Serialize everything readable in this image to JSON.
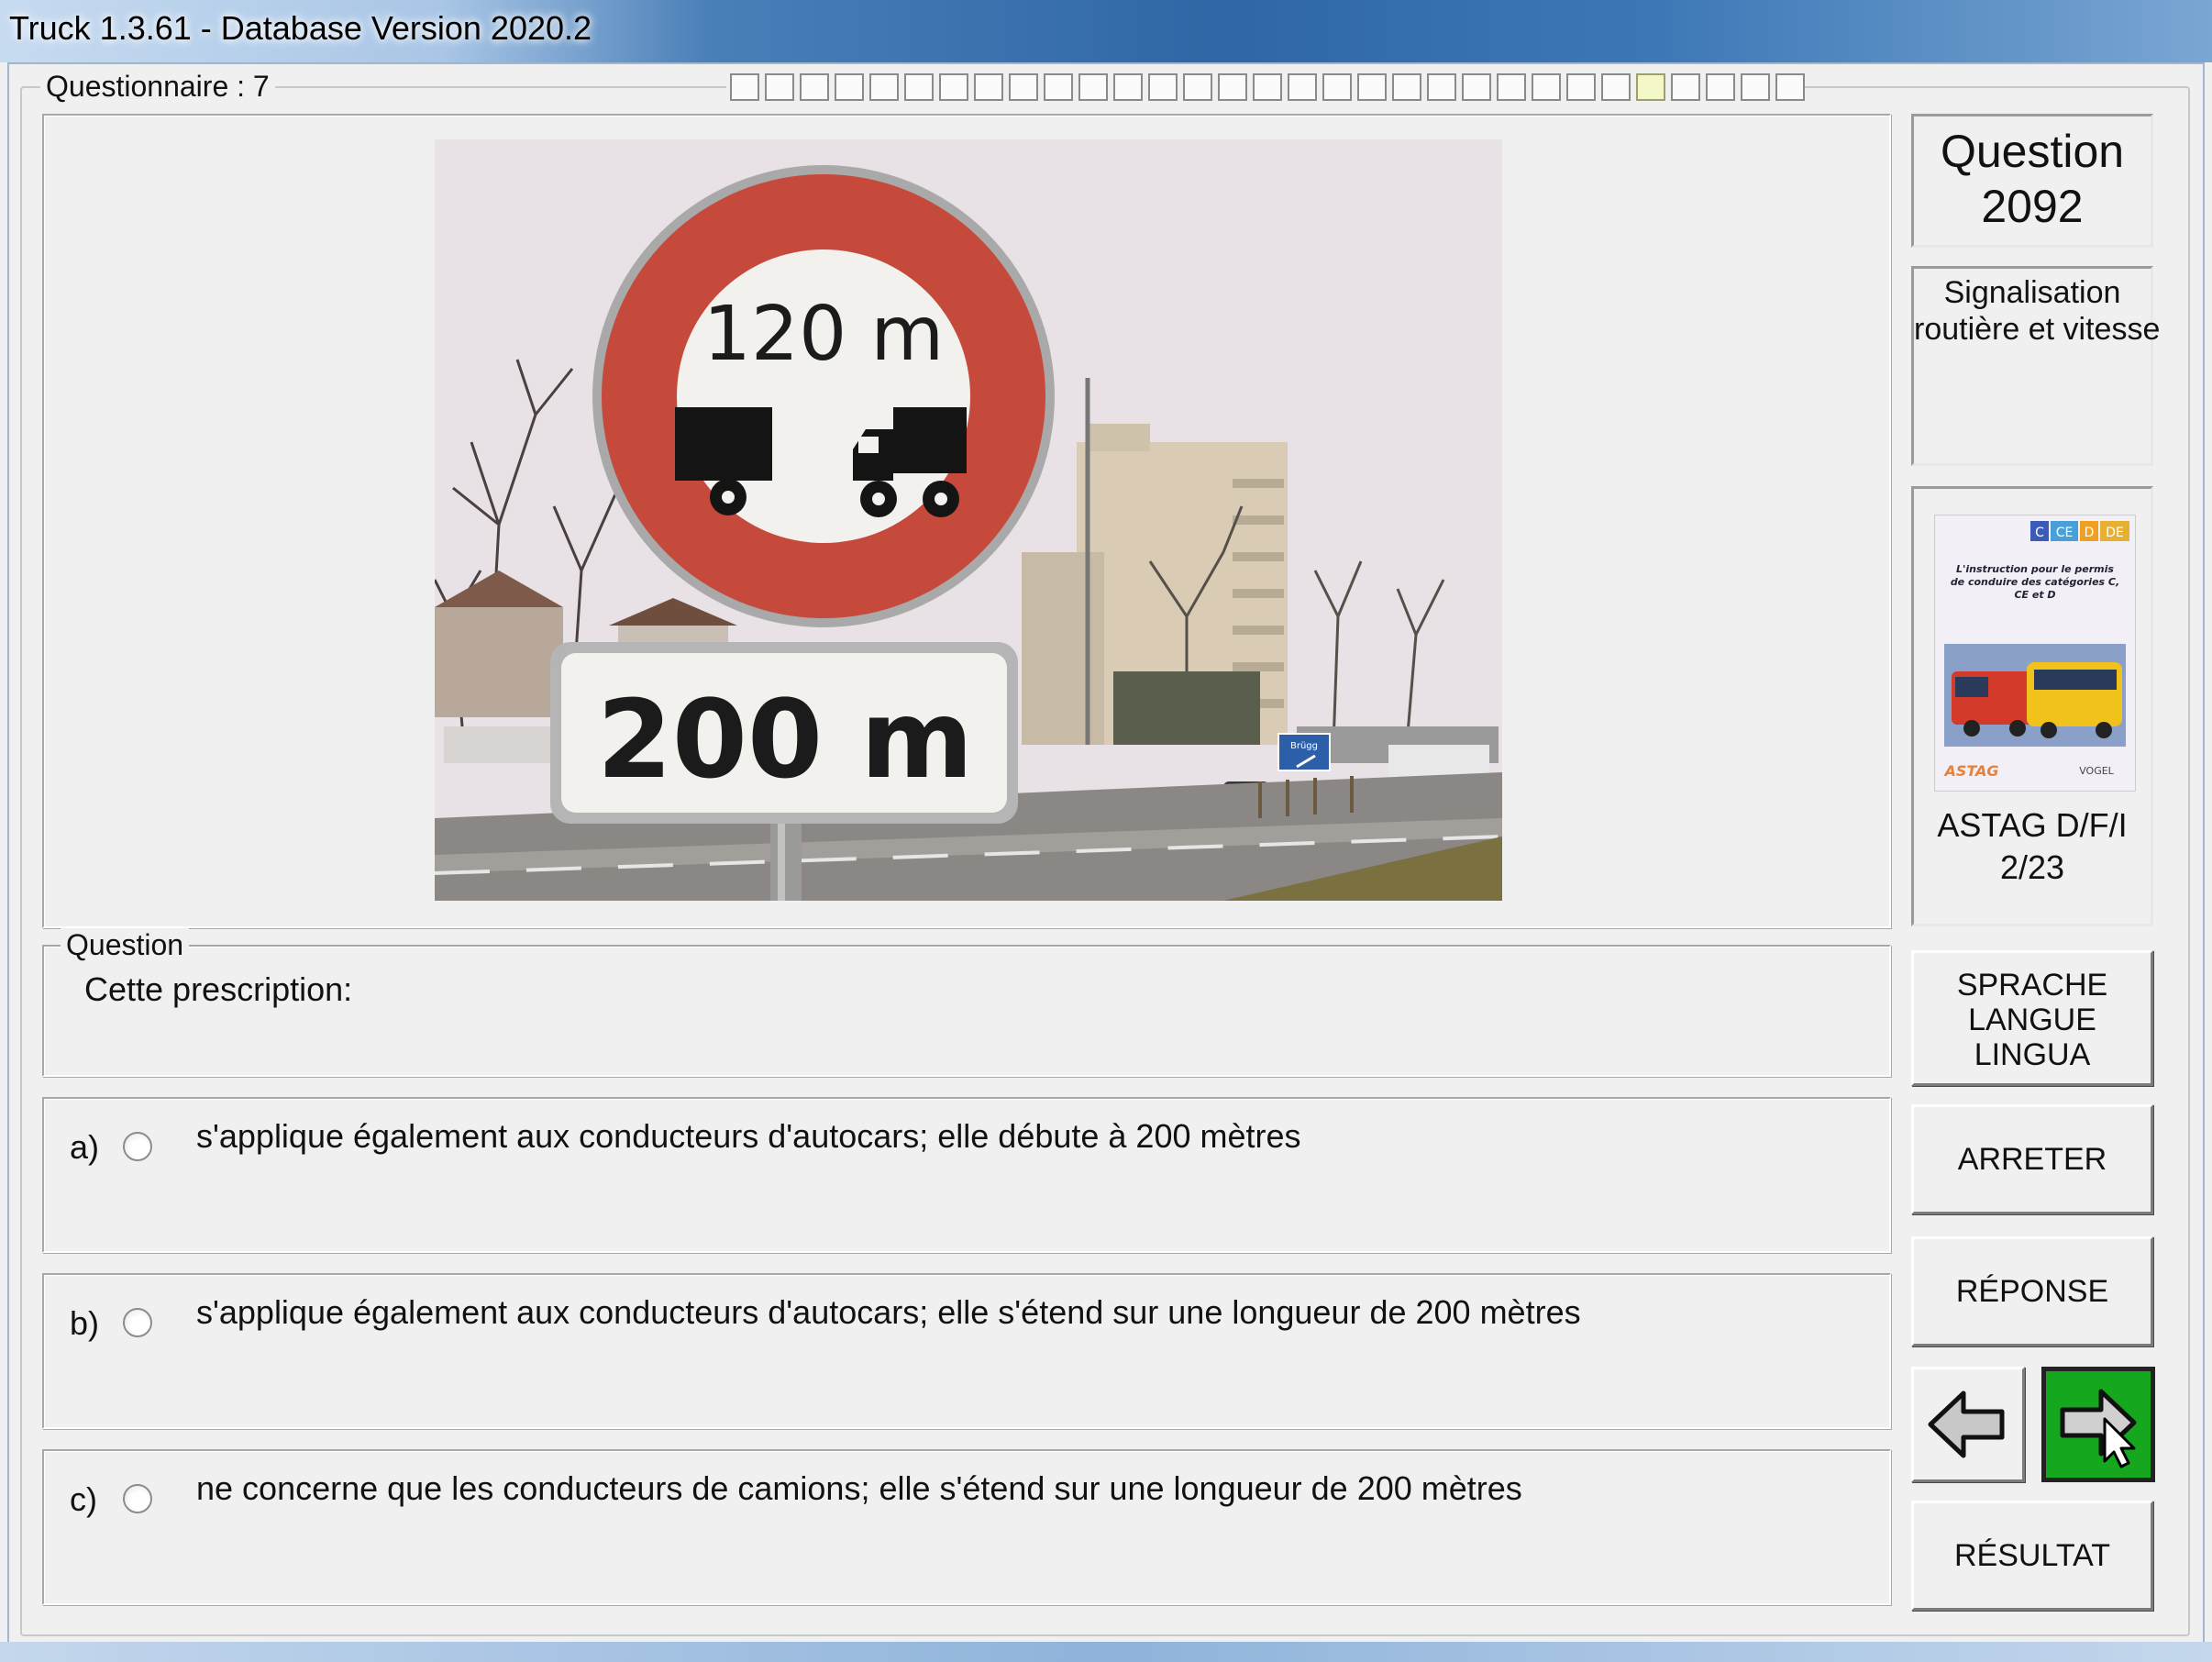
{
  "window": {
    "title": "Truck 1.3.61 - Database Version 2020.2"
  },
  "questionnaire": {
    "label": "Questionnaire : 7",
    "progress_total": 31,
    "progress_current_index": 26
  },
  "photo": {
    "sign_top": "120 m",
    "sign_plate": "200 m",
    "blue_sign": "Brügg"
  },
  "question": {
    "legend": "Question",
    "text": "Cette prescription:"
  },
  "answers": [
    {
      "letter": "a)",
      "text": "s'applique également aux conducteurs d'autocars; elle débute à 200 mètres"
    },
    {
      "letter": "b)",
      "text": "s'applique également aux conducteurs d'autocars; elle s'étend sur une longueur de 200 mètres"
    },
    {
      "letter": "c)",
      "text": "ne concerne que les conducteurs de camions; elle s'étend sur une longueur de 200 mètres"
    }
  ],
  "sidebar": {
    "question_label": "Question",
    "question_number": "2092",
    "category_line1": "Signalisation",
    "category_line2": "routière et vitesse",
    "book_caption_line1": "ASTAG D/F/I",
    "book_caption_line2": "2/23",
    "book": {
      "badges": [
        "C",
        "CE",
        "D",
        "DE"
      ],
      "title": "L'instruction pour le permis de conduire des catégories C, CE et D",
      "logo_left": "ASTAG",
      "logo_right": "VOGEL"
    }
  },
  "buttons": {
    "language_line1": "SPRACHE",
    "language_line2": "LANGUE",
    "language_line3": "LINGUA",
    "stop": "ARRETER",
    "answer": "RÉPONSE",
    "result": "RÉSULTAT"
  },
  "colors": {
    "next_button": "#15a81e",
    "progress_current": "#f4f7c8",
    "sign_red": "#c0392b"
  }
}
